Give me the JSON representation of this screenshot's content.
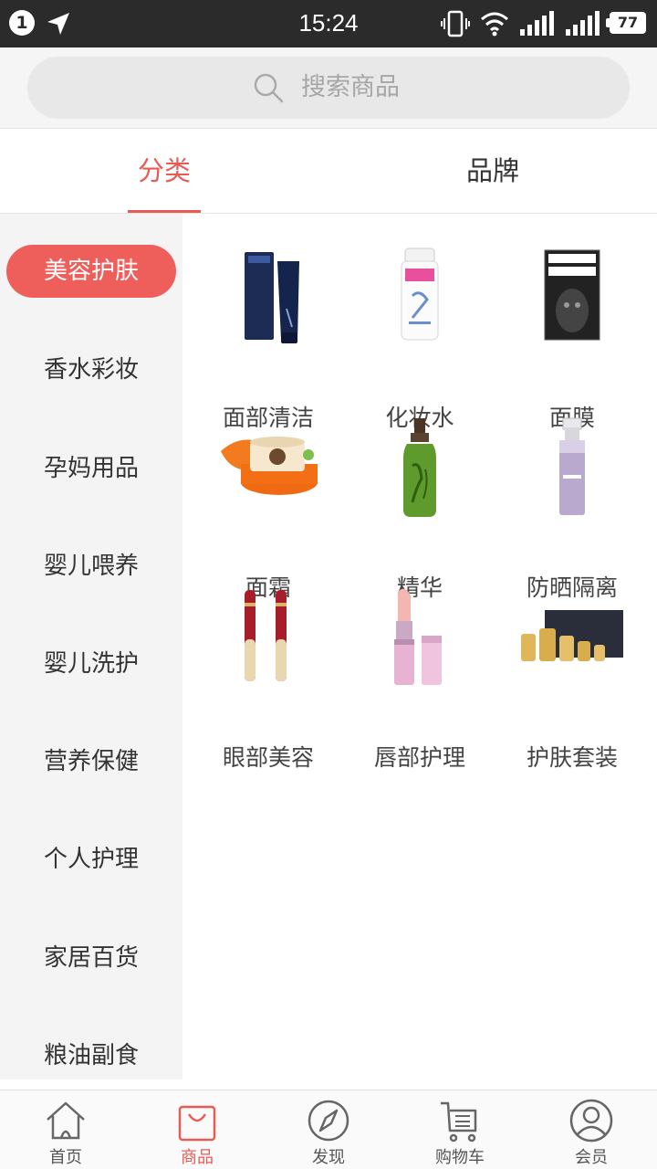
{
  "status_bar": {
    "notification_count": "1",
    "time": "15:24",
    "battery": "77",
    "icons": [
      "location-arrow-icon",
      "vibrate-icon",
      "wifi-icon",
      "signal-icon",
      "signal-icon",
      "battery-icon"
    ]
  },
  "search": {
    "placeholder": "搜索商品"
  },
  "tabs": [
    {
      "label": "分类",
      "active": true
    },
    {
      "label": "品牌",
      "active": false
    }
  ],
  "sidebar": {
    "items": [
      {
        "label": "美容护肤",
        "active": true
      },
      {
        "label": "香水彩妆"
      },
      {
        "label": "孕妈用品"
      },
      {
        "label": "婴儿喂养"
      },
      {
        "label": "婴儿洗护"
      },
      {
        "label": "营养保健"
      },
      {
        "label": "个人护理"
      },
      {
        "label": "家居百货"
      },
      {
        "label": "粮油副食"
      }
    ]
  },
  "categories": [
    {
      "label": "面部清洁",
      "icon": "cleanser-tube-image"
    },
    {
      "label": "化妆水",
      "icon": "toner-bottle-image"
    },
    {
      "label": "面膜",
      "icon": "face-mask-pack-image"
    },
    {
      "label": "面霜",
      "icon": "cream-jar-image"
    },
    {
      "label": "精华",
      "icon": "serum-bottle-image"
    },
    {
      "label": "防晒隔离",
      "icon": "sunscreen-bottle-image"
    },
    {
      "label": "眼部美容",
      "icon": "eye-cream-image"
    },
    {
      "label": "唇部护理",
      "icon": "lip-balm-image"
    },
    {
      "label": "护肤套装",
      "icon": "skincare-set-image"
    }
  ],
  "bottom_nav": [
    {
      "label": "首页",
      "icon": "home-icon"
    },
    {
      "label": "商品",
      "icon": "shopping-bag-icon",
      "active": true
    },
    {
      "label": "发现",
      "icon": "compass-icon"
    },
    {
      "label": "购物车",
      "icon": "cart-icon"
    },
    {
      "label": "会员",
      "icon": "user-icon"
    }
  ],
  "colors": {
    "accent": "#e95a55",
    "status_bar": "#2b2b2b",
    "sidebar_bg": "#f4f4f4"
  }
}
